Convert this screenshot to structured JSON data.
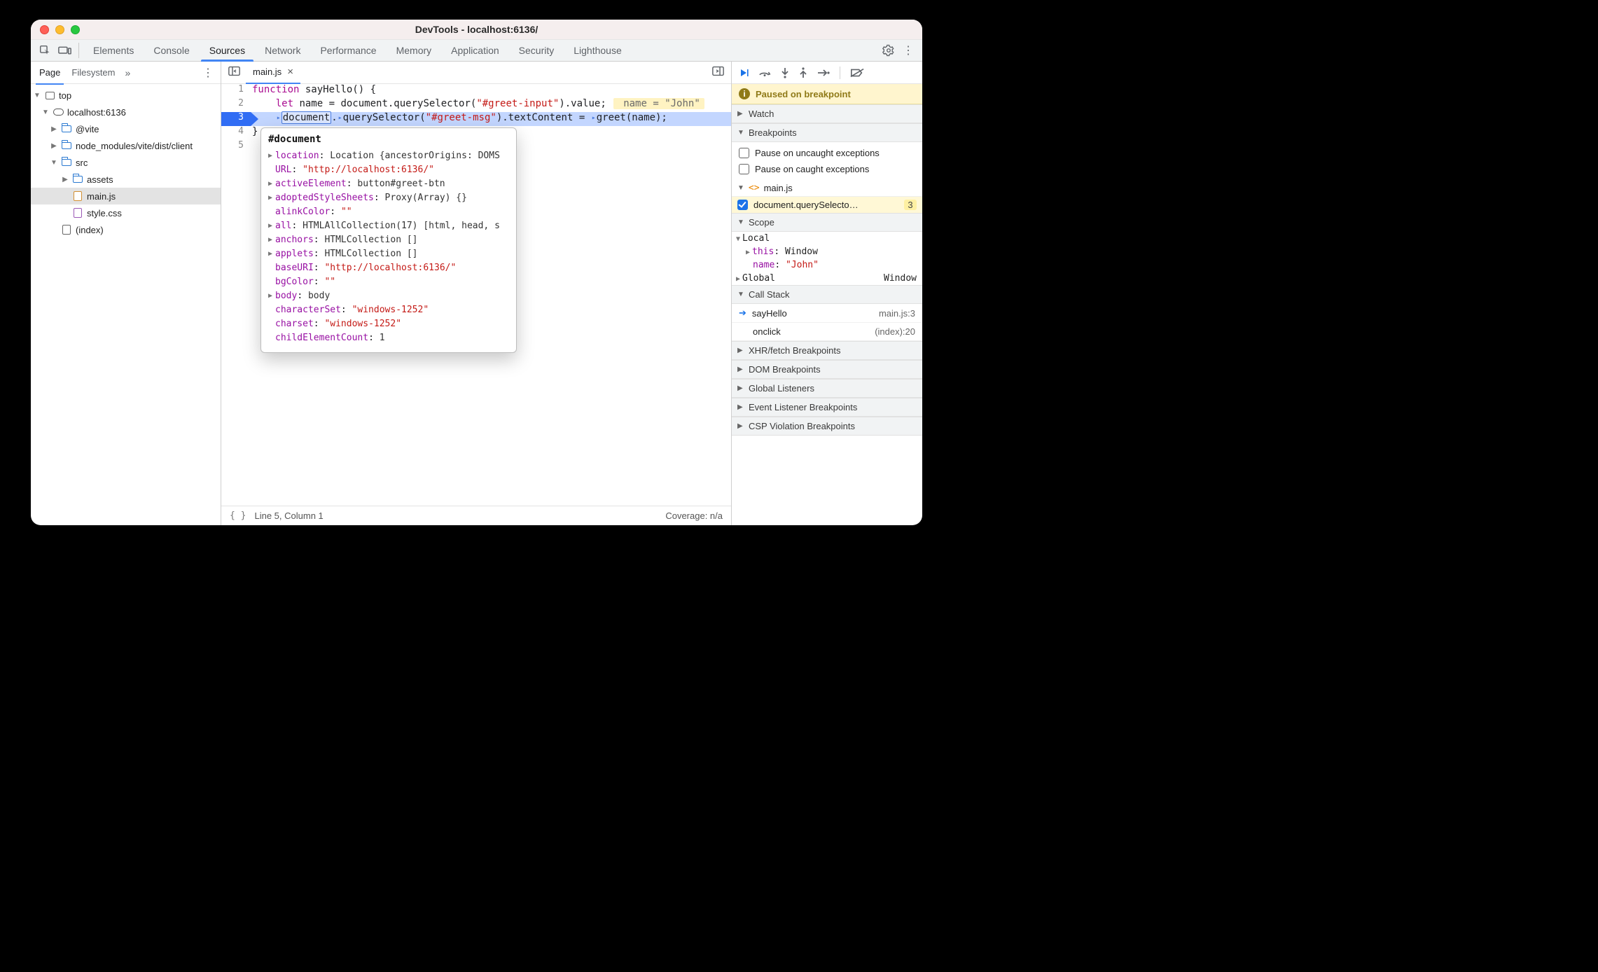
{
  "window_title": "DevTools - localhost:6136/",
  "top_tabs": [
    "Elements",
    "Console",
    "Sources",
    "Network",
    "Performance",
    "Memory",
    "Application",
    "Security",
    "Lighthouse"
  ],
  "active_top_tab": "Sources",
  "left": {
    "tabs": {
      "page": "Page",
      "filesystem": "Filesystem"
    },
    "tree": {
      "top": "top",
      "host": "localhost:6136",
      "folders": {
        "vite": "@vite",
        "node_modules": "node_modules/vite/dist/client",
        "src": "src",
        "assets": "assets"
      },
      "files": {
        "mainjs": "main.js",
        "stylecss": "style.css",
        "index": "(index)"
      }
    }
  },
  "editor": {
    "tab": "main.js",
    "lines": {
      "l1": {
        "kw": "function",
        "fn": " sayHello",
        "rest": "() {"
      },
      "l2": {
        "indent": "    ",
        "kw": "let",
        "name": " name ",
        "eq": "= document.querySelector(",
        "str": "\"#greet-input\"",
        "rest": ").value;",
        "inline": " name = \"John\""
      },
      "l3": {
        "indent": "    ",
        "hover": "document",
        "mid": ".",
        "mid2": "querySelector(",
        "str": "\"#greet-msg\"",
        "rest": ").textContent = ",
        "tail": "greet(name);"
      },
      "l4": "}",
      "l5": ""
    },
    "status": {
      "pos": "Line 5, Column 1",
      "coverage": "Coverage: n/a"
    }
  },
  "popover": {
    "title": "#document",
    "rows": [
      {
        "caret": true,
        "key": "location",
        "val": "Location {ancestorOrigins: DOMS",
        "type": "obj"
      },
      {
        "key": "URL",
        "val": "\"http://localhost:6136/\"",
        "type": "str"
      },
      {
        "caret": true,
        "key": "activeElement",
        "val": "button#greet-btn",
        "type": "obj"
      },
      {
        "caret": true,
        "key": "adoptedStyleSheets",
        "val": "Proxy(Array) {}",
        "type": "obj"
      },
      {
        "key": "alinkColor",
        "val": "\"\"",
        "type": "str"
      },
      {
        "caret": true,
        "key": "all",
        "val": "HTMLAllCollection(17) [html, head, s",
        "type": "obj"
      },
      {
        "caret": true,
        "key": "anchors",
        "val": "HTMLCollection []",
        "type": "obj"
      },
      {
        "caret": true,
        "key": "applets",
        "val": "HTMLCollection []",
        "type": "obj"
      },
      {
        "key": "baseURI",
        "val": "\"http://localhost:6136/\"",
        "type": "str"
      },
      {
        "key": "bgColor",
        "val": "\"\"",
        "type": "str"
      },
      {
        "caret": true,
        "key": "body",
        "val": "body",
        "type": "obj"
      },
      {
        "key": "characterSet",
        "val": "\"windows-1252\"",
        "type": "str"
      },
      {
        "key": "charset",
        "val": "\"windows-1252\"",
        "type": "str"
      },
      {
        "key": "childElementCount",
        "val": "1",
        "type": "obj"
      }
    ]
  },
  "dbg": {
    "paused": "Paused on breakpoint",
    "sections": {
      "watch": "Watch",
      "breakpoints": "Breakpoints",
      "scope": "Scope",
      "callstack": "Call Stack",
      "xhr": "XHR/fetch Breakpoints",
      "dom": "DOM Breakpoints",
      "gl": "Global Listeners",
      "el": "Event Listener Breakpoints",
      "csp": "CSP Violation Breakpoints"
    },
    "bp_options": {
      "uncaught": "Pause on uncaught exceptions",
      "caught": "Pause on caught exceptions"
    },
    "bp_file": "main.js",
    "bp_text": "document.querySelecto…",
    "bp_line": "3",
    "scope": {
      "local": "Local",
      "this_k": "this",
      "this_v": "Window",
      "name_k": "name",
      "name_v": "\"John\"",
      "global": "Global",
      "global_v": "Window"
    },
    "stack": [
      {
        "fn": "sayHello",
        "loc": "main.js:3",
        "current": true
      },
      {
        "fn": "onclick",
        "loc": "(index):20"
      }
    ]
  }
}
